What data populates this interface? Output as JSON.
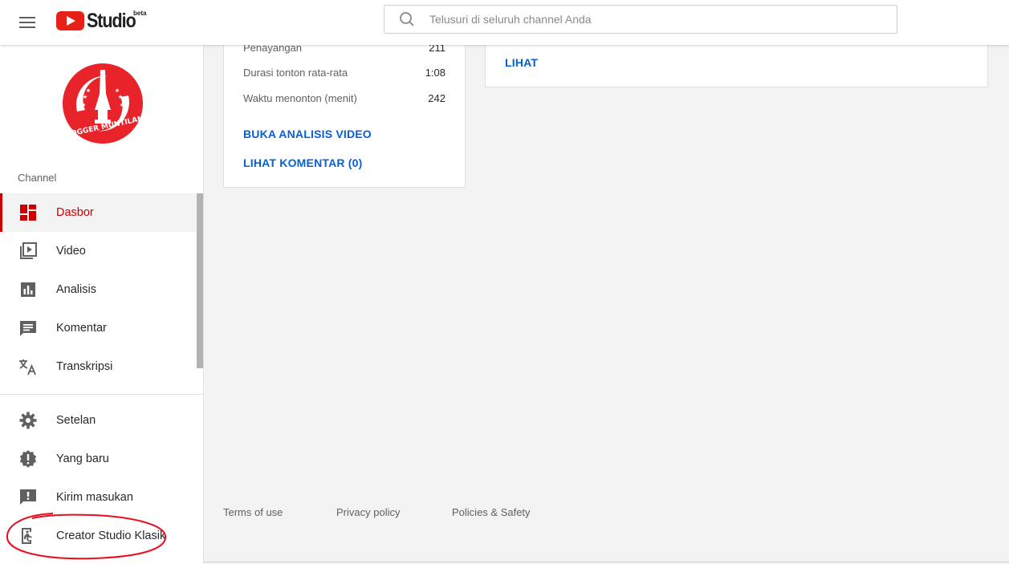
{
  "header": {
    "brand": "Studio",
    "beta": "beta",
    "search_placeholder": "Telusuri di seluruh channel Anda"
  },
  "sidebar": {
    "avatar_text": "BLOGGER MUNTILAN",
    "section_label": "Channel",
    "items": [
      {
        "label": "Dasbor",
        "icon": "dashboard-icon",
        "active": true
      },
      {
        "label": "Video",
        "icon": "video-library-icon"
      },
      {
        "label": "Analisis",
        "icon": "analytics-icon"
      },
      {
        "label": "Komentar",
        "icon": "comment-icon"
      },
      {
        "label": "Transkripsi",
        "icon": "translate-icon"
      }
    ],
    "bottom_items": [
      {
        "label": "Setelan",
        "icon": "gear-icon"
      },
      {
        "label": "Yang baru",
        "icon": "new-badge-icon"
      },
      {
        "label": "Kirim masukan",
        "icon": "feedback-icon"
      },
      {
        "label": "Creator Studio Klasik",
        "icon": "exit-classic-icon"
      }
    ]
  },
  "video_card": {
    "stats": [
      {
        "label": "Penayangan",
        "value": "211"
      },
      {
        "label": "Durasi tonton rata-rata",
        "value": "1:08"
      },
      {
        "label": "Waktu menonton (menit)",
        "value": "242"
      }
    ],
    "analytics_link": "BUKA ANALISIS VIDEO",
    "comments_link": "LIHAT KOMENTAR (0)"
  },
  "right_card": {
    "link": "LIHAT"
  },
  "footer": {
    "terms": "Terms of use",
    "privacy": "Privacy policy",
    "policies": "Policies & Safety"
  },
  "colors": {
    "brand_red": "#cc0000",
    "link_blue": "#065fd4",
    "annotation_red": "#e8101e"
  }
}
